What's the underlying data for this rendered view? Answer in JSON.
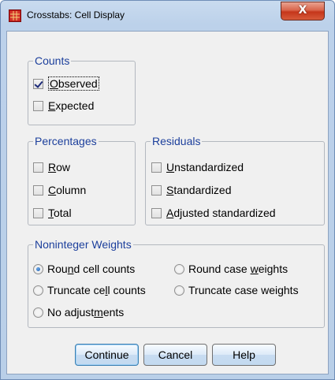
{
  "window": {
    "title": "Crosstabs: Cell Display",
    "close_glyph": "X"
  },
  "counts": {
    "label": "Counts",
    "items": [
      {
        "label": "Observed",
        "mnemonic": "O",
        "checked": true
      },
      {
        "label": "Expected",
        "mnemonic": "E",
        "checked": false
      }
    ]
  },
  "percentages": {
    "label": "Percentages",
    "items": [
      {
        "label": "Row",
        "mnemonic": "R",
        "checked": false
      },
      {
        "label": "Column",
        "mnemonic": "C",
        "checked": false
      },
      {
        "label": "Total",
        "mnemonic": "T",
        "checked": false
      }
    ]
  },
  "residuals": {
    "label": "Residuals",
    "items": [
      {
        "label": "Unstandardized",
        "mnemonic": "U",
        "checked": false
      },
      {
        "label": "Standardized",
        "mnemonic": "S",
        "checked": false
      },
      {
        "label": "Adjusted standardized",
        "mnemonic": "A",
        "checked": false
      }
    ]
  },
  "weights": {
    "label": "Noninteger Weights",
    "selected": "Round cell counts",
    "options": [
      {
        "label": "Round cell counts",
        "pre": "Rou",
        "key": "n",
        "post": "d cell counts"
      },
      {
        "label": "Round case weights",
        "pre": "Round case ",
        "key": "w",
        "post": "eights"
      },
      {
        "label": "Truncate cell counts",
        "pre": "Truncate ce",
        "key": "l",
        "post": "l counts"
      },
      {
        "label": "Truncate case weights",
        "pre": "Truncate case wei",
        "key": "g",
        "post": "hts"
      },
      {
        "label": "No adjustments",
        "pre": "No adjust",
        "key": "m",
        "post": "ents"
      }
    ]
  },
  "buttons": {
    "continue": "Continue",
    "cancel": "Cancel",
    "help": "Help"
  }
}
